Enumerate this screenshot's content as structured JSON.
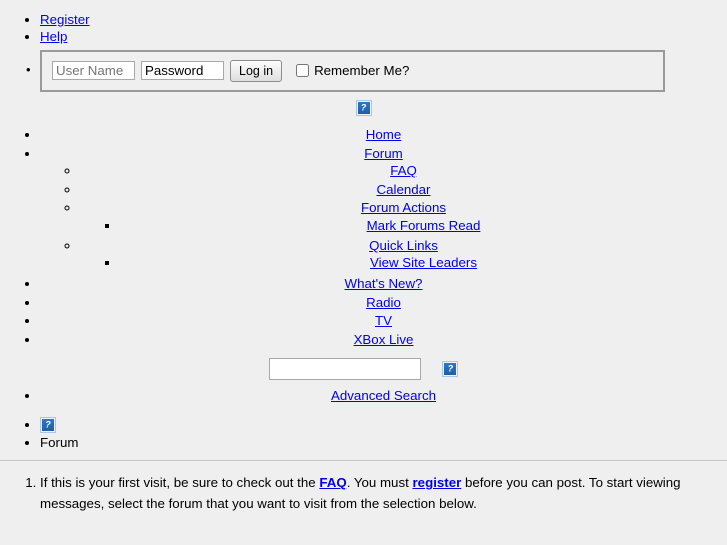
{
  "account": {
    "register_label": "Register",
    "help_label": "Help",
    "login_form": {
      "username_placeholder": "User Name",
      "password_value": "Password",
      "login_button_label": "Log in",
      "remember_label": "Remember Me?"
    }
  },
  "logo": {
    "alt": "broken-image"
  },
  "nav": {
    "home": "Home",
    "forum": "Forum",
    "forum_children": {
      "faq": "FAQ",
      "calendar": "Calendar",
      "forum_actions": "Forum Actions",
      "forum_actions_children": {
        "mark_forums_read": "Mark Forums Read"
      },
      "quick_links": "Quick Links",
      "quick_links_children": {
        "view_site_leaders": "View Site Leaders"
      }
    },
    "whats_new": "What's New?",
    "radio": "Radio",
    "tv": "TV",
    "xbox_live": "XBox Live"
  },
  "search": {
    "value": "",
    "placeholder": "",
    "go_icon_alt": "broken-image",
    "advanced_search": "Advanced Search"
  },
  "breadcrumb": {
    "home_icon_alt": "broken-image",
    "forum": "Forum"
  },
  "first_visit": {
    "part1": "If this is your first visit, be sure to check out the ",
    "faq_link": "FAQ",
    "part2": ". You must ",
    "register_link": "register",
    "part3": " before you can post. To start viewing messages, select the forum that you want to visit from the selection below."
  },
  "colors": {
    "page_background": "#efefef",
    "link": "#0000ee",
    "placeholder_text": "#757575",
    "fieldset_border": "#9a9a9a",
    "rule": "#c4c4c4"
  }
}
